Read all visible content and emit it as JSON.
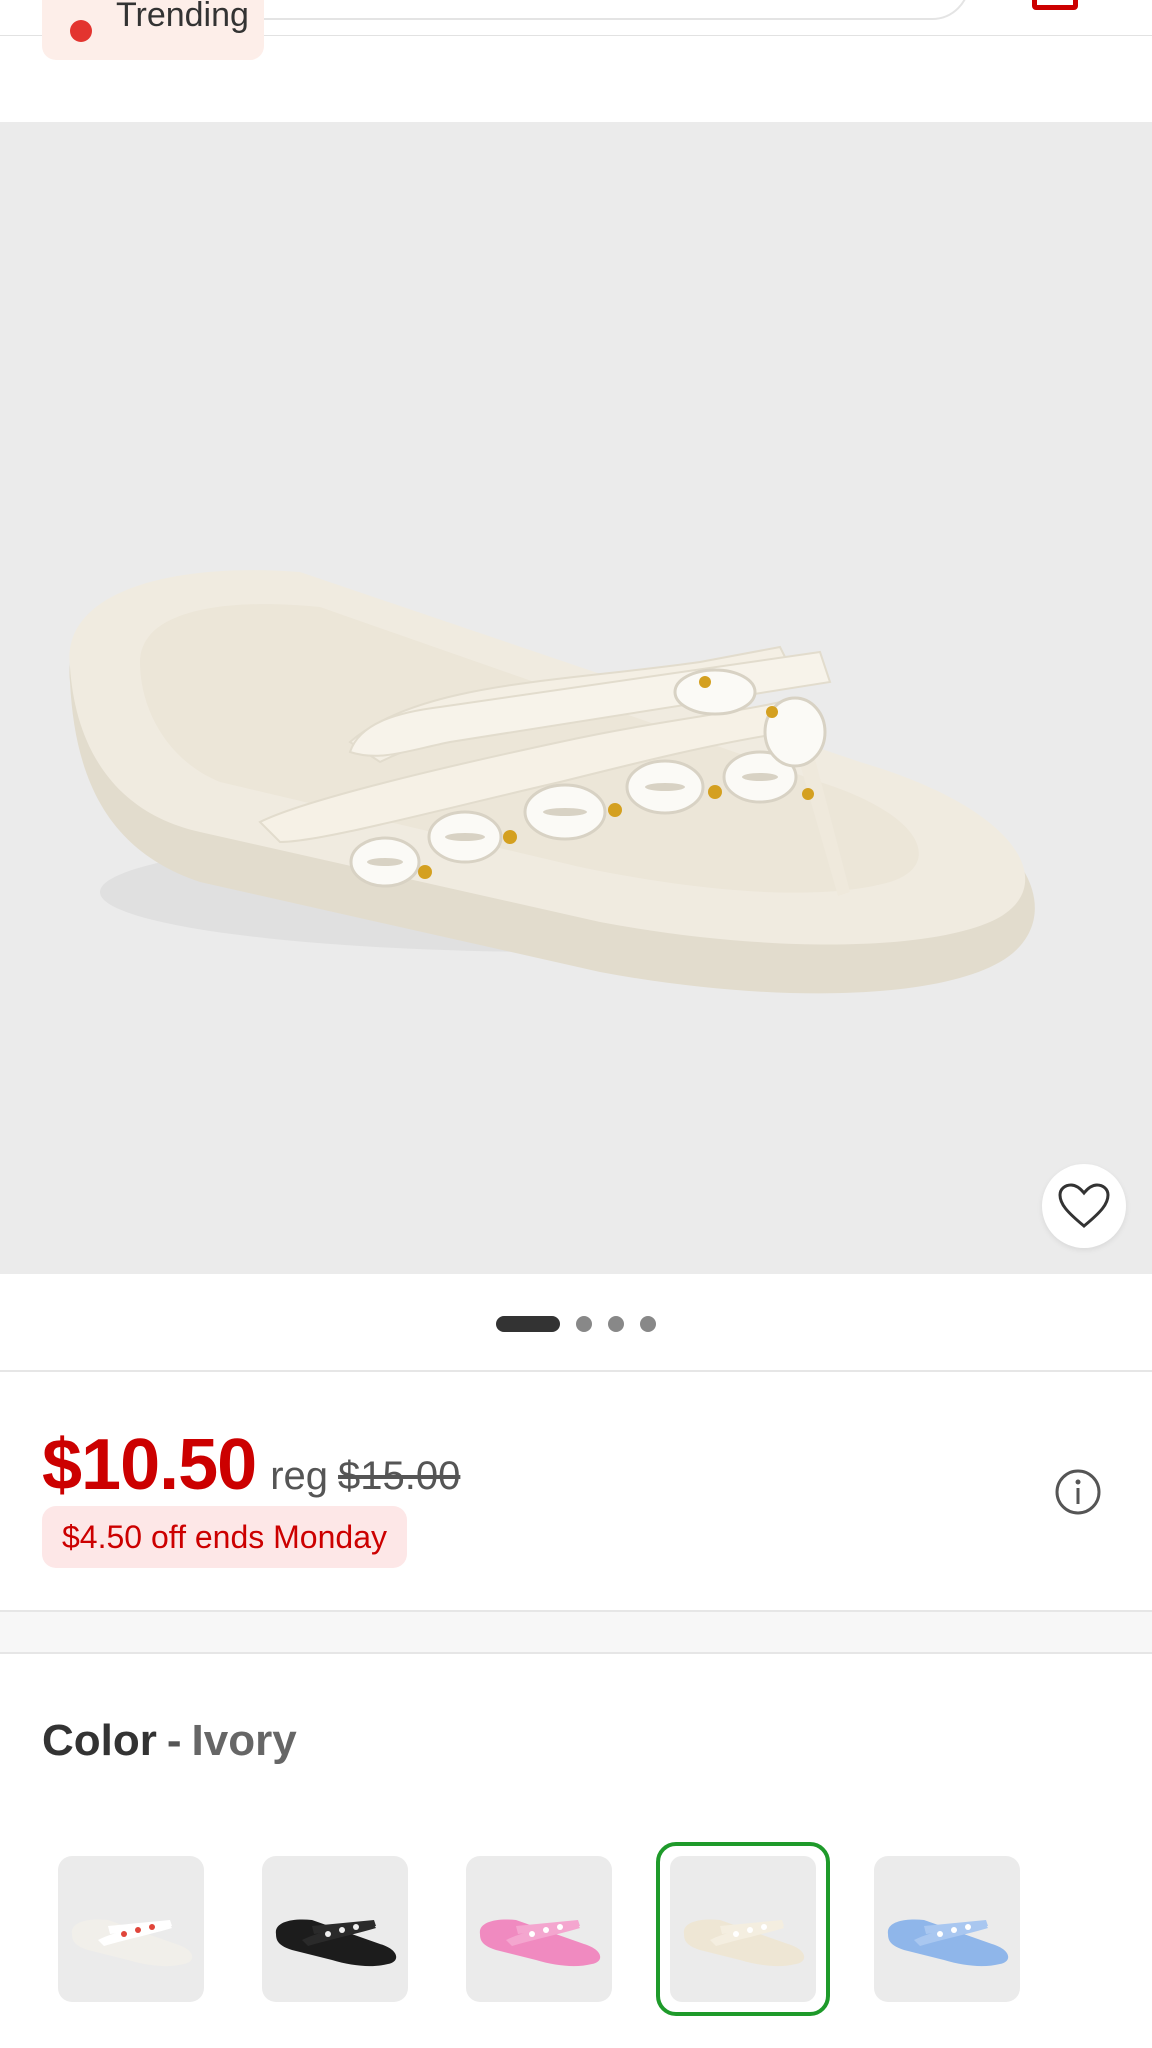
{
  "header": {
    "trending_label": "Trending"
  },
  "product": {
    "image_alt": "Ivory platform flip flop sandal with cowrie shell strap",
    "favorite_icon": "heart-outline-icon",
    "carousel": {
      "total": 4,
      "active_index": 0
    }
  },
  "price": {
    "current": "$10.50",
    "reg_label": "reg",
    "regular": "$15.00",
    "promo": "$4.50 off ends Monday",
    "info_icon": "info-circle-icon"
  },
  "color": {
    "label": "Color",
    "separator": "-",
    "selected": "Ivory",
    "selected_index": 3,
    "selected_border_color": "#1e9a2a",
    "swatches": [
      {
        "name": "White multi",
        "base": "#f1efea",
        "strap": "#ffffff",
        "accent": "#e0453a"
      },
      {
        "name": "Black",
        "base": "#1c1c1c",
        "strap": "#2a2a2a",
        "accent": "#f0f0f0"
      },
      {
        "name": "Pink",
        "base": "#f08ac0",
        "strap": "#f4a6cf",
        "accent": "#ffffff"
      },
      {
        "name": "Ivory",
        "base": "#eee6d4",
        "strap": "#f4eee0",
        "accent": "#ffffff"
      },
      {
        "name": "Blue",
        "base": "#8fb6ea",
        "strap": "#a9c7f0",
        "accent": "#ffffff"
      }
    ]
  },
  "colors": {
    "price_red": "#cc0000",
    "promo_bg": "#fde7e7",
    "image_bg": "#ebebeb"
  }
}
